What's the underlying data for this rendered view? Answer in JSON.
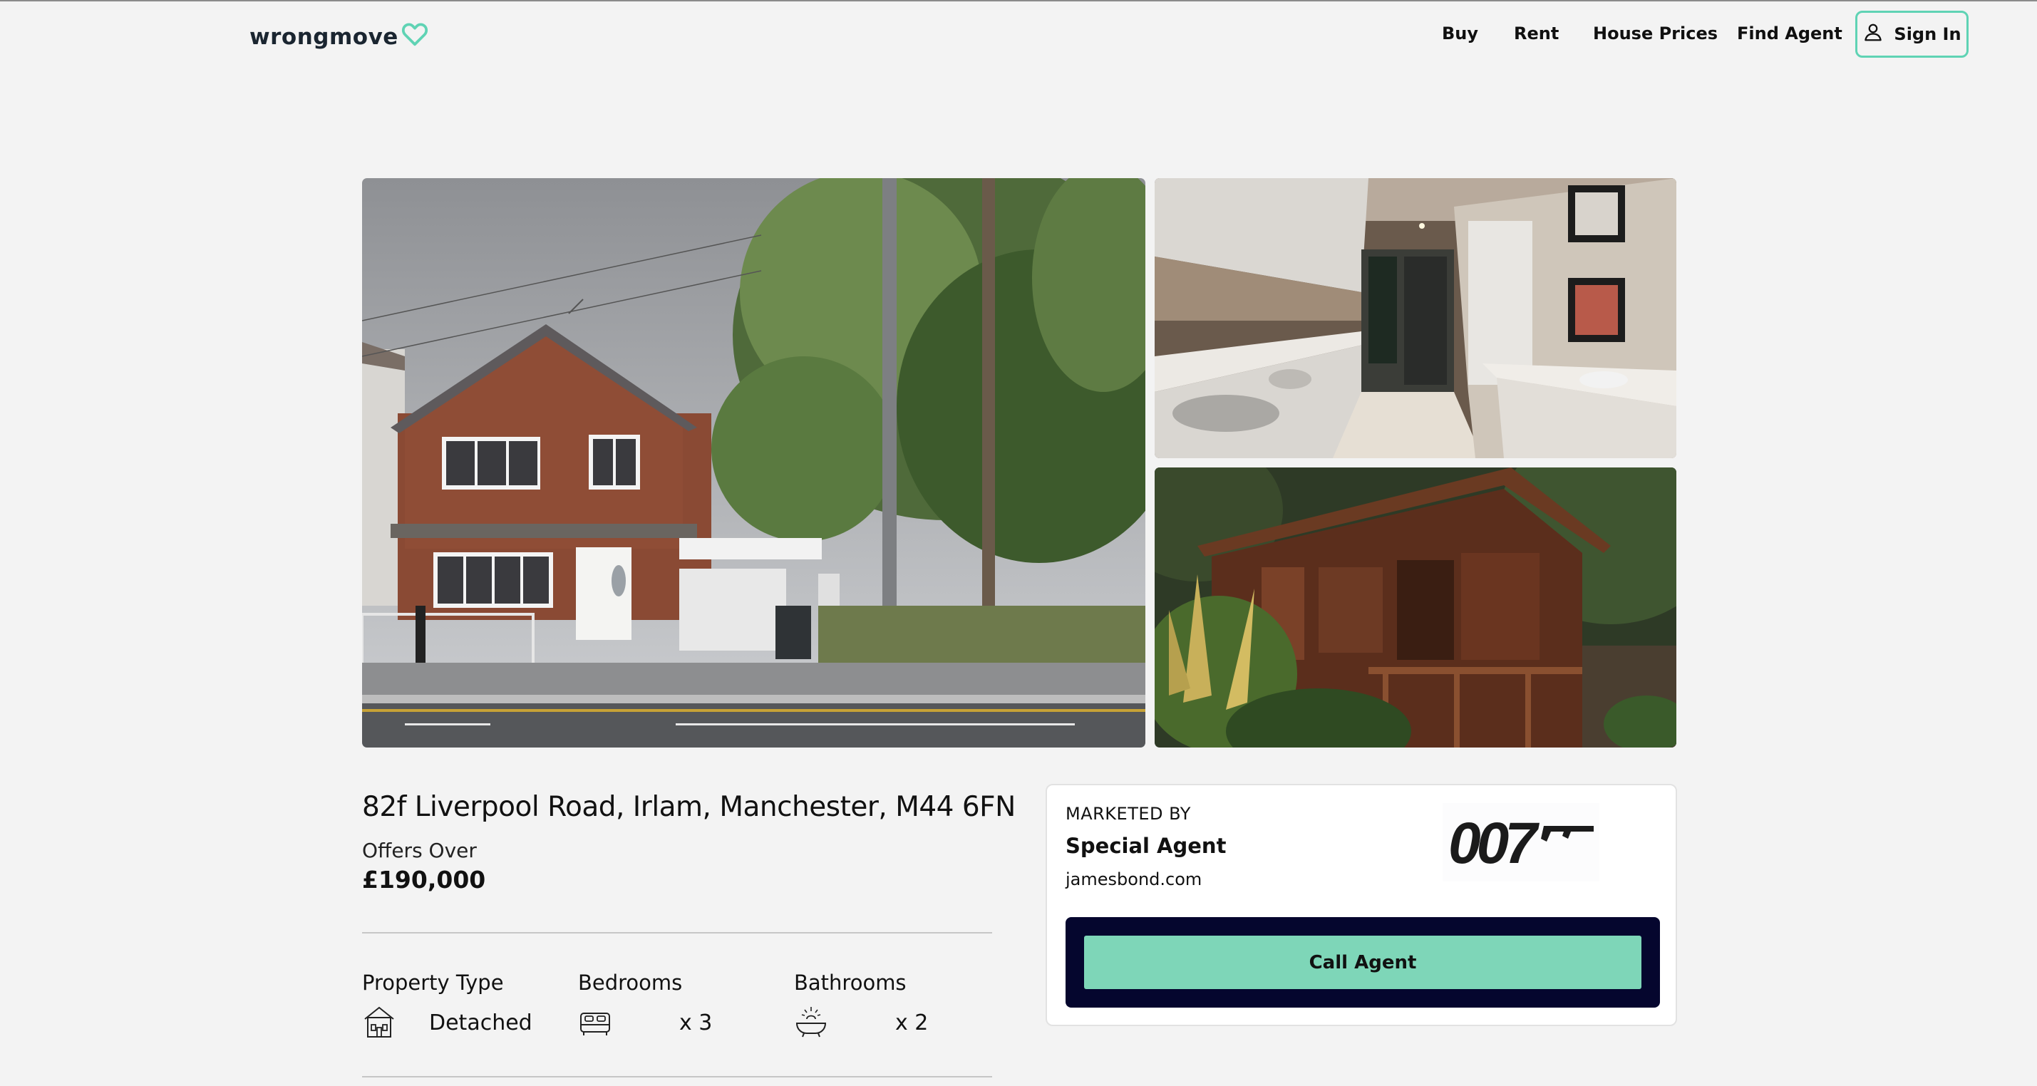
{
  "header": {
    "logo_text": "wrongmove",
    "nav": [
      "Buy",
      "Rent",
      "House Prices",
      "Find Agent"
    ],
    "sign_in_label": "Sign In"
  },
  "listing": {
    "address": "82f Liverpool Road, Irlam, Manchester, M44 6FN",
    "price_qualifier": "Offers Over",
    "price": "£190,000",
    "features": [
      {
        "heading": "Property Type",
        "value": "Detached",
        "icon": "house-icon"
      },
      {
        "heading": "Bedrooms",
        "value": "x 3",
        "icon": "bed-icon"
      },
      {
        "heading": "Bathrooms",
        "value": "x 2",
        "icon": "bath-icon"
      }
    ]
  },
  "agent": {
    "marketed_by_label": "MARKETED BY",
    "name": "Special Agent",
    "website": "jamesbond.com",
    "logo_text": "007",
    "call_label": "Call Agent"
  },
  "colors": {
    "accent": "#7ed6b8",
    "accent_border": "#5fd3b4",
    "navy": "#05062e",
    "background": "#f3f3f3"
  }
}
